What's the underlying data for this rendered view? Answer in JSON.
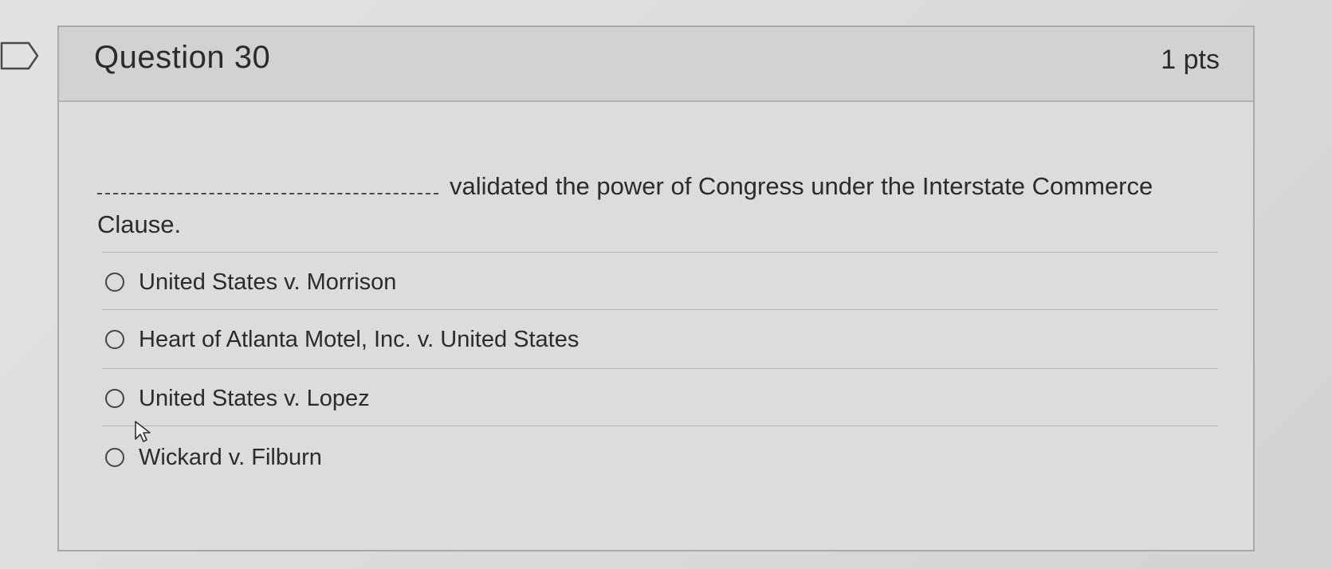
{
  "question": {
    "title": "Question 30",
    "points": "1 pts",
    "stem_text": "validated the power of Congress under the Interstate Commerce Clause."
  },
  "answers": [
    {
      "label": "United States v. Morrison",
      "selected": false
    },
    {
      "label": "Heart of Atlanta Motel, Inc. v. United States",
      "selected": false
    },
    {
      "label": "United States v. Lopez",
      "selected": false
    },
    {
      "label": "Wickard v. Filburn",
      "selected": false
    }
  ],
  "icons": {
    "flag": "flag-outline-icon",
    "cursor": "mouse-pointer-icon"
  },
  "colors": {
    "text": "#2b2b2b",
    "header_bg": "#d2d2d0",
    "card_bg": "#dcdcda",
    "border": "#a9a9a7"
  }
}
